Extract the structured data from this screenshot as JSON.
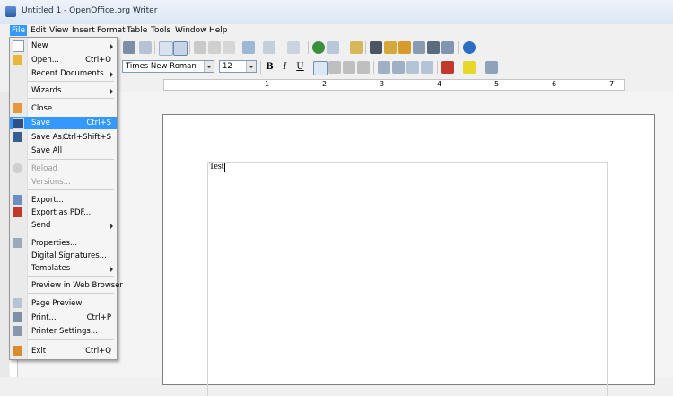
{
  "window": {
    "title": "Untitled 1 - OpenOffice.org Writer"
  },
  "menubar": [
    "File",
    "Edit",
    "View",
    "Insert",
    "Format",
    "Table",
    "Tools",
    "Window",
    "Help"
  ],
  "formatting": {
    "font_name": "Times New Roman",
    "font_size": "12",
    "bold": "B",
    "italic": "I",
    "underline": "U"
  },
  "ruler": {
    "marks": [
      "1",
      "2",
      "3",
      "4",
      "5",
      "6",
      "7"
    ]
  },
  "document": {
    "text": "Test"
  },
  "file_menu": {
    "items": [
      {
        "label": "New",
        "shortcut": "",
        "submenu": true,
        "enabled": true,
        "icon": "new-document-icon"
      },
      {
        "label": "Open...",
        "shortcut": "Ctrl+O",
        "submenu": false,
        "enabled": true,
        "icon": "open-folder-icon"
      },
      {
        "label": "Recent Documents",
        "shortcut": "",
        "submenu": true,
        "enabled": true,
        "icon": ""
      },
      {
        "label": "Wizards",
        "shortcut": "",
        "submenu": true,
        "enabled": true,
        "icon": ""
      },
      {
        "label": "Close",
        "shortcut": "",
        "submenu": false,
        "enabled": true,
        "icon": "close-document-icon"
      },
      {
        "label": "Save",
        "shortcut": "Ctrl+S",
        "submenu": false,
        "enabled": true,
        "icon": "save-icon"
      },
      {
        "label": "Save As...",
        "shortcut": "Ctrl+Shift+S",
        "submenu": false,
        "enabled": true,
        "icon": "save-as-icon"
      },
      {
        "label": "Save All",
        "shortcut": "",
        "submenu": false,
        "enabled": true,
        "icon": ""
      },
      {
        "label": "Reload",
        "shortcut": "",
        "submenu": false,
        "enabled": false,
        "icon": "reload-icon"
      },
      {
        "label": "Versions...",
        "shortcut": "",
        "submenu": false,
        "enabled": false,
        "icon": ""
      },
      {
        "label": "Export...",
        "shortcut": "",
        "submenu": false,
        "enabled": true,
        "icon": "export-icon"
      },
      {
        "label": "Export as PDF...",
        "shortcut": "",
        "submenu": false,
        "enabled": true,
        "icon": "pdf-icon"
      },
      {
        "label": "Send",
        "shortcut": "",
        "submenu": true,
        "enabled": true,
        "icon": ""
      },
      {
        "label": "Properties...",
        "shortcut": "",
        "submenu": false,
        "enabled": true,
        "icon": "properties-icon"
      },
      {
        "label": "Digital Signatures...",
        "shortcut": "",
        "submenu": false,
        "enabled": true,
        "icon": ""
      },
      {
        "label": "Templates",
        "shortcut": "",
        "submenu": true,
        "enabled": true,
        "icon": ""
      },
      {
        "label": "Preview in Web Browser",
        "shortcut": "",
        "submenu": false,
        "enabled": true,
        "icon": ""
      },
      {
        "label": "Page Preview",
        "shortcut": "",
        "submenu": false,
        "enabled": true,
        "icon": "page-preview-icon"
      },
      {
        "label": "Print...",
        "shortcut": "Ctrl+P",
        "submenu": false,
        "enabled": true,
        "icon": "print-icon"
      },
      {
        "label": "Printer Settings...",
        "shortcut": "",
        "submenu": false,
        "enabled": true,
        "icon": "printer-settings-icon"
      },
      {
        "label": "Exit",
        "shortcut": "Ctrl+Q",
        "submenu": false,
        "enabled": true,
        "icon": "exit-icon"
      }
    ],
    "highlighted": "Save"
  },
  "colors": {
    "menu_highlight": "#3399ff",
    "titlebar": "#dbe6f4"
  }
}
